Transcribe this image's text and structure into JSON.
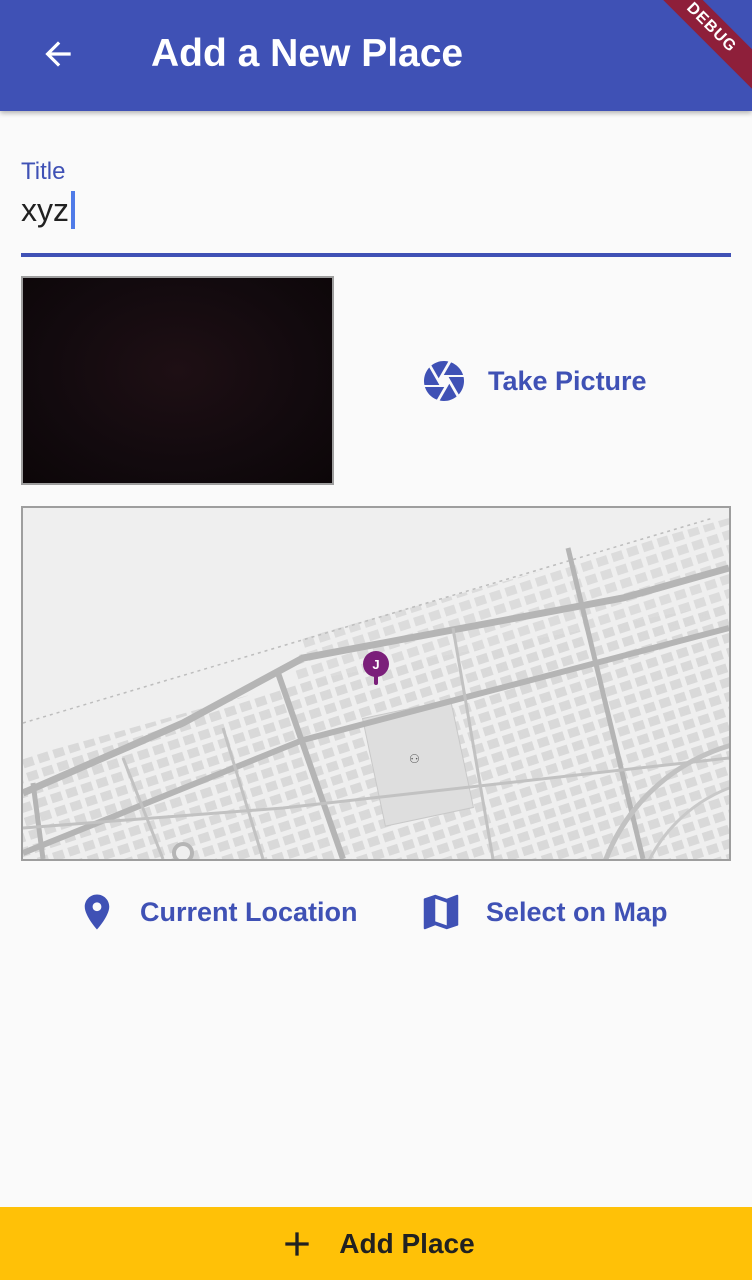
{
  "appbar": {
    "title": "Add a New Place",
    "background_color": "#3f51b5",
    "back_icon": "arrow-back-icon",
    "debug_banner": "DEBUG"
  },
  "form": {
    "title_label": "Title",
    "title_value": "xyz"
  },
  "image_section": {
    "take_picture_label": "Take Picture",
    "take_picture_icon": "camera-shutter-icon"
  },
  "map_section": {
    "marker_letter": "J",
    "marker_color": "#7b1f7a"
  },
  "location_actions": {
    "current_location_label": "Current Location",
    "current_location_icon": "location-pin-icon",
    "select_on_map_label": "Select on Map",
    "select_on_map_icon": "map-icon"
  },
  "footer": {
    "add_place_label": "Add Place",
    "add_icon": "plus-icon",
    "background_color": "#ffc107"
  },
  "colors": {
    "primary": "#3f51b5",
    "accent": "#ffc107",
    "caret": "#4f7be8"
  }
}
